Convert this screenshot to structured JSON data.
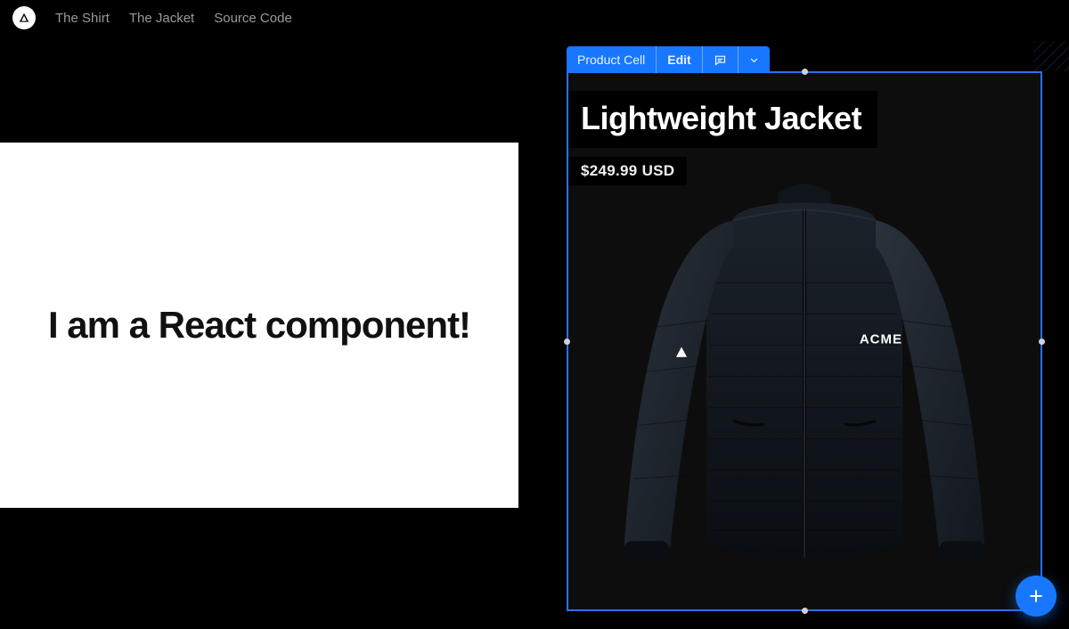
{
  "nav": {
    "items": [
      {
        "label": "The Shirt"
      },
      {
        "label": "The Jacket"
      },
      {
        "label": "Source Code"
      }
    ]
  },
  "left_panel": {
    "text": "I am a React component!"
  },
  "toolbar": {
    "component_label": "Product Cell",
    "edit_label": "Edit",
    "comment_icon": "comment-icon",
    "dropdown_icon": "chevron-down-icon"
  },
  "product": {
    "title": "Lightweight Jacket",
    "price": "$249.99 USD",
    "brand_on_garment": "ACME"
  },
  "fab": {
    "icon": "plus-icon"
  },
  "colors": {
    "accent": "#1877ff",
    "selection_handle": "#cfd2d8"
  }
}
